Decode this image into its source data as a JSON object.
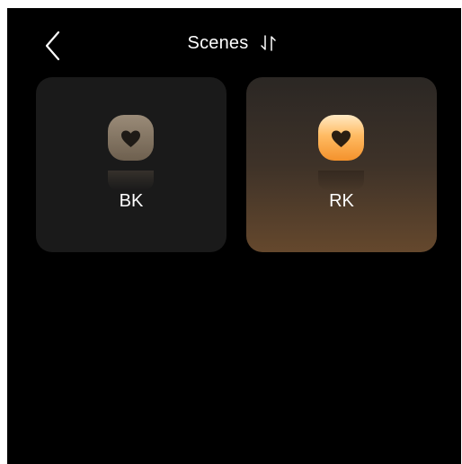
{
  "header": {
    "back_icon": "chevron-left-icon",
    "title": "Scenes",
    "sort_icon": "sort-arrows-icon"
  },
  "scenes": [
    {
      "label": "BK",
      "icon": "heart-icon",
      "active": false,
      "icon_color": "#8a7a66"
    },
    {
      "label": "RK",
      "icon": "heart-icon",
      "active": true,
      "icon_color": "#ffb45a"
    }
  ],
  "colors": {
    "background": "#000000",
    "card_inactive": "#1a1a1a",
    "card_active_bottom": "#65482d",
    "text": "#ffffff"
  }
}
